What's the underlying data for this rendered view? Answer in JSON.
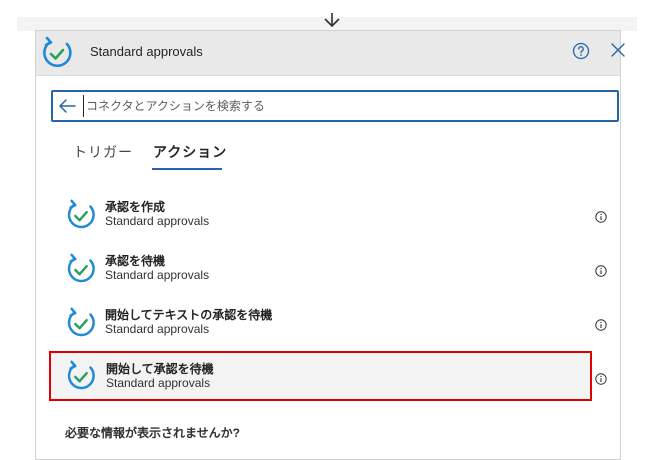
{
  "header": {
    "title": "Standard approvals",
    "icon": "approvals-icon",
    "help_icon": "help-icon",
    "close_icon": "close-icon"
  },
  "search": {
    "placeholder": "コネクタとアクションを検索する",
    "value": ""
  },
  "tabs": [
    {
      "label": "トリガー",
      "active": false
    },
    {
      "label": "アクション",
      "active": true
    }
  ],
  "actions": [
    {
      "title": "承認を作成",
      "connector": "Standard approvals",
      "selected": false
    },
    {
      "title": "承認を待機",
      "connector": "Standard approvals",
      "selected": false
    },
    {
      "title": "開始してテキストの承認を待機",
      "connector": "Standard approvals",
      "selected": false
    },
    {
      "title": "開始して承認を待機",
      "connector": "Standard approvals",
      "selected": true
    }
  ],
  "footer": {
    "missing_info": "必要な情報が表示されませんか?"
  },
  "colors": {
    "accent": "#2566a8",
    "icon_blue": "#1f8ad8",
    "icon_green": "#2e9d62",
    "selection_border": "#e00000"
  }
}
